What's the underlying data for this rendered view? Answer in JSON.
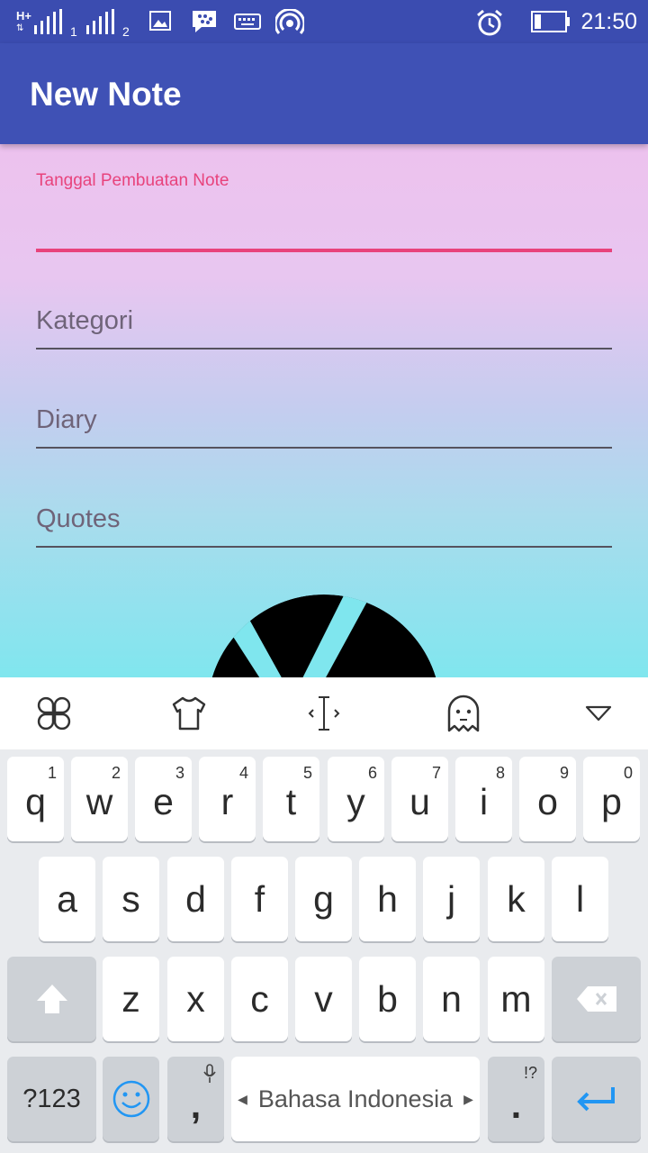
{
  "status_bar": {
    "network_label": "H+",
    "sim1": "1",
    "sim2": "2",
    "time": "21:50"
  },
  "app_bar": {
    "title": "New Note"
  },
  "form": {
    "date_label": "Tanggal Pembuatan Note",
    "date_value": "",
    "kategori_placeholder": "Kategori",
    "diary_placeholder": "Diary",
    "quotes_placeholder": "Quotes"
  },
  "keyboard": {
    "toolbar_icons": [
      "clover-icon",
      "shirt-icon",
      "cursor-icon",
      "ghost-icon",
      "collapse-icon"
    ],
    "row1": [
      {
        "key": "q",
        "hint": "1"
      },
      {
        "key": "w",
        "hint": "2"
      },
      {
        "key": "e",
        "hint": "3"
      },
      {
        "key": "r",
        "hint": "4"
      },
      {
        "key": "t",
        "hint": "5"
      },
      {
        "key": "y",
        "hint": "6"
      },
      {
        "key": "u",
        "hint": "7"
      },
      {
        "key": "i",
        "hint": "8"
      },
      {
        "key": "o",
        "hint": "9"
      },
      {
        "key": "p",
        "hint": "0"
      }
    ],
    "row2": [
      "a",
      "s",
      "d",
      "f",
      "g",
      "h",
      "j",
      "k",
      "l"
    ],
    "row3": [
      "z",
      "x",
      "c",
      "v",
      "b",
      "n",
      "m"
    ],
    "symbols_label": "?123",
    "comma": ",",
    "space_label": "Bahasa Indonesia",
    "period": ".",
    "period_hint": "!?",
    "colors": {
      "accent": "#2196f3",
      "app_bar": "#3f51b5",
      "field_active": "#e8437c"
    }
  }
}
